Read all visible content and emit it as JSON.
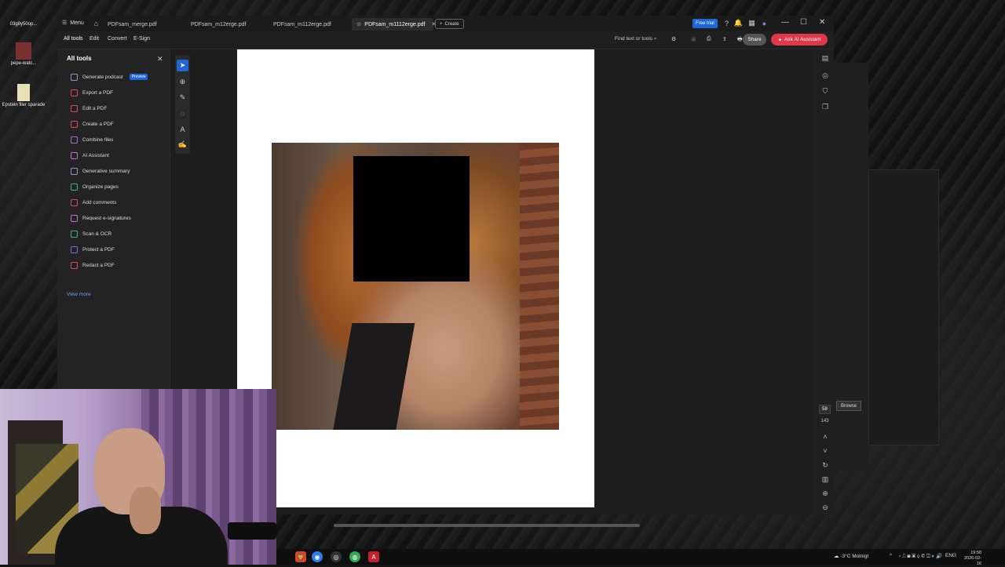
{
  "desktop": {
    "icons": [
      {
        "label": "03g8y50op..."
      },
      {
        "label": "pepe-watc..."
      },
      {
        "label": "Epstein filer sparade"
      }
    ]
  },
  "window": {
    "menu_label": "Menu",
    "tabs": [
      {
        "label": "PDFsam_merge.pdf"
      },
      {
        "label": "PDFsam_m12erge.pdf"
      },
      {
        "label": "PDFsam_m112erge.pdf"
      },
      {
        "label": "PDFsam_m1112erge.pdf",
        "active": true
      }
    ],
    "create_label": "Create",
    "free_trial_label": "Free trial"
  },
  "menubar": {
    "items": [
      "All tools",
      "Edit",
      "Convert",
      "E-Sign"
    ],
    "find_label": "Find text or tools",
    "share_label": "Share",
    "ask_ai_label": "Ask AI Assistant"
  },
  "tools_panel": {
    "title": "All tools",
    "items": [
      {
        "label": "Generate podcast",
        "badge": "Preview",
        "color": "#8a9bd6"
      },
      {
        "label": "Export a PDF",
        "color": "#e0485a"
      },
      {
        "label": "Edit a PDF",
        "color": "#e0485a"
      },
      {
        "label": "Create a PDF",
        "color": "#e0485a"
      },
      {
        "label": "Combine files",
        "color": "#b867d8"
      },
      {
        "label": "AI Assistant",
        "color": "#c86bd6"
      },
      {
        "label": "Generative summary",
        "color": "#8a9bd6"
      },
      {
        "label": "Organize pages",
        "color": "#3cb878"
      },
      {
        "label": "Add comments",
        "color": "#e0485a"
      },
      {
        "label": "Request e-signatures",
        "color": "#c86bd6"
      },
      {
        "label": "Scan & OCR",
        "color": "#3cb878"
      },
      {
        "label": "Protect a PDF",
        "color": "#7b6ee0"
      },
      {
        "label": "Redact a PDF",
        "color": "#e0485a"
      }
    ],
    "view_more": "View more"
  },
  "page_nav": {
    "current_page": "58",
    "total_pages": "143"
  },
  "background_window": {
    "browse_label": "Browse"
  },
  "taskbar": {
    "weather": "-3°C  Molnigt",
    "lang": "ENG",
    "time": "19:58",
    "date": "2026-02-16"
  },
  "colors": {
    "accent_blue": "#2166d6",
    "ask_ai_red": "#e0384a",
    "window_bg": "#1f1f1f"
  }
}
